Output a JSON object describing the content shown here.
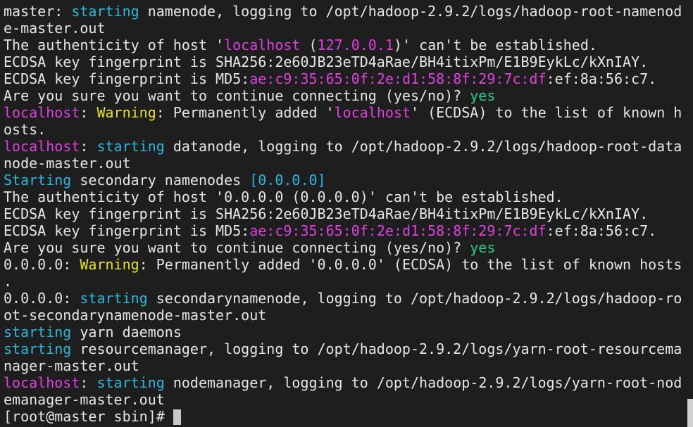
{
  "terminal": {
    "prompt": "[root@master sbin]# ",
    "lines": [
      [
        {
          "t": "master: ",
          "c": "w"
        },
        {
          "t": "starting",
          "c": "c"
        },
        {
          "t": " namenode, logging to /opt/hadoop-2.9.2/logs/hadoop-root-namenod",
          "c": "w"
        }
      ],
      [
        {
          "t": "e-master.out",
          "c": "w"
        }
      ],
      [
        {
          "t": "The authenticity of host '",
          "c": "w"
        },
        {
          "t": "localhost",
          "c": "m"
        },
        {
          "t": " (",
          "c": "w"
        },
        {
          "t": "127.0.0.1",
          "c": "m"
        },
        {
          "t": ")' can't be established.",
          "c": "w"
        }
      ],
      [
        {
          "t": "ECDSA key fingerprint is SHA256:2e60JB23eTD4aRae/BH4itixPm/E1B9EykLc/kXnIAY.",
          "c": "w"
        }
      ],
      [
        {
          "t": "ECDSA key fingerprint is MD5:",
          "c": "w"
        },
        {
          "t": "ae:c9:35:65:0f:2e:d1:58:8f:29:7c:df",
          "c": "m"
        },
        {
          "t": ":ef:8a:56:c7.",
          "c": "w"
        }
      ],
      [
        {
          "t": "Are you sure you want to continue connecting (yes/no)? ",
          "c": "w"
        },
        {
          "t": "yes",
          "c": "g"
        }
      ],
      [
        {
          "t": "localhost",
          "c": "m"
        },
        {
          "t": ": ",
          "c": "w"
        },
        {
          "t": "Warning",
          "c": "y"
        },
        {
          "t": ": Permanently added '",
          "c": "w"
        },
        {
          "t": "localhost",
          "c": "m"
        },
        {
          "t": "' (ECDSA) to the list of known h",
          "c": "w"
        }
      ],
      [
        {
          "t": "osts.",
          "c": "w"
        }
      ],
      [
        {
          "t": "localhost",
          "c": "m"
        },
        {
          "t": ": ",
          "c": "w"
        },
        {
          "t": "starting",
          "c": "c"
        },
        {
          "t": " datanode, logging to /opt/hadoop-2.9.2/logs/hadoop-root-data",
          "c": "w"
        }
      ],
      [
        {
          "t": "node-master.out",
          "c": "w"
        }
      ],
      [
        {
          "t": "Starting",
          "c": "c"
        },
        {
          "t": " secondary namenodes ",
          "c": "w"
        },
        {
          "t": "[0.0.0.0]",
          "c": "c"
        }
      ],
      [
        {
          "t": "The authenticity of host '0.0.0.0 (0.0.0.0)' can't be established.",
          "c": "w"
        }
      ],
      [
        {
          "t": "ECDSA key fingerprint is SHA256:2e60JB23eTD4aRae/BH4itixPm/E1B9EykLc/kXnIAY.",
          "c": "w"
        }
      ],
      [
        {
          "t": "ECDSA key fingerprint is MD5:",
          "c": "w"
        },
        {
          "t": "ae:c9:35:65:0f:2e:d1:58:8f:29:7c:df",
          "c": "m"
        },
        {
          "t": ":ef:8a:56:c7.",
          "c": "w"
        }
      ],
      [
        {
          "t": "Are you sure you want to continue connecting (yes/no)? ",
          "c": "w"
        },
        {
          "t": "yes",
          "c": "g"
        }
      ],
      [
        {
          "t": "0.0.0.0: ",
          "c": "w"
        },
        {
          "t": "Warning",
          "c": "y"
        },
        {
          "t": ": Permanently added '0.0.0.0' (ECDSA) to the list of known hosts",
          "c": "w"
        }
      ],
      [
        {
          "t": ".",
          "c": "w"
        }
      ],
      [
        {
          "t": "0.0.0.0: ",
          "c": "w"
        },
        {
          "t": "starting",
          "c": "c"
        },
        {
          "t": " secondarynamenode, logging to /opt/hadoop-2.9.2/logs/hadoop-ro",
          "c": "w"
        }
      ],
      [
        {
          "t": "ot-secondarynamenode-master.out",
          "c": "w"
        }
      ],
      [
        {
          "t": "starting",
          "c": "c"
        },
        {
          "t": " yarn daemons",
          "c": "w"
        }
      ],
      [
        {
          "t": "starting",
          "c": "c"
        },
        {
          "t": " resourcemanager, logging to /opt/hadoop-2.9.2/logs/yarn-root-resourcema",
          "c": "w"
        }
      ],
      [
        {
          "t": "nager-master.out",
          "c": "w"
        }
      ],
      [
        {
          "t": "localhost",
          "c": "m"
        },
        {
          "t": ": ",
          "c": "w"
        },
        {
          "t": "starting",
          "c": "c"
        },
        {
          "t": " nodemanager, logging to /opt/hadoop-2.9.2/logs/yarn-root-nod",
          "c": "w"
        }
      ],
      [
        {
          "t": "emanager-master.out",
          "c": "w"
        }
      ]
    ]
  },
  "colors": {
    "background": "#1e1e1e",
    "text": "#e6e6e6",
    "magenta": "#e040e0",
    "yellow": "#e5e510",
    "green": "#23d18b",
    "cyan": "#29b8db",
    "cursor": "#c8c8c8"
  }
}
